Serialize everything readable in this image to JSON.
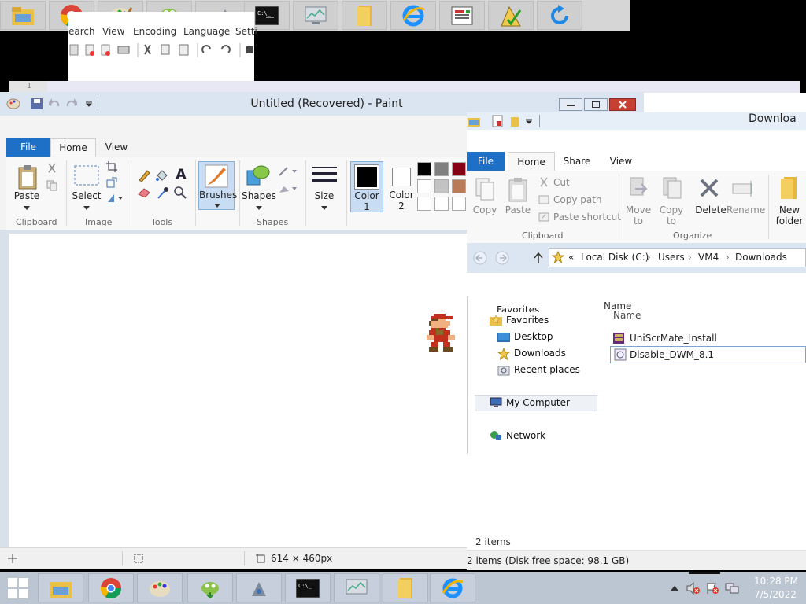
{
  "top_taskbar": {
    "icons": [
      "file-explorer-icon",
      "chrome-icon",
      "paint-icon",
      "notepadpp-icon",
      "utility-icon",
      "cmd-icon",
      "monitor-icon",
      "folder-icon",
      "ie-icon",
      "presentation-icon",
      "accessibility-icon",
      "refresh-icon"
    ]
  },
  "notepadpp": {
    "menu": [
      "earch",
      "View",
      "Encoding",
      "Language",
      "Setti"
    ],
    "line_number": "1"
  },
  "paint": {
    "title": "Untitled (Recovered) - Paint",
    "tabs": {
      "file": "File",
      "home": "Home",
      "view": "View"
    },
    "clipboard": {
      "paste": "Paste",
      "group": "Clipboard"
    },
    "image": {
      "select": "Select",
      "group": "Image"
    },
    "tools": {
      "group": "Tools"
    },
    "brushes": {
      "label": "Brushes"
    },
    "shapes": {
      "label": "Shapes",
      "group": "Shapes"
    },
    "size": {
      "label": "Size"
    },
    "color1": {
      "label": "Color",
      "num": "1"
    },
    "color2": {
      "label": "Color",
      "num": "2"
    },
    "status": {
      "dimensions": "614 × 460px"
    },
    "palette": [
      "#000000",
      "#7f7f7f",
      "#880015",
      "#ffffff",
      "#c3c3c3",
      "#b97a57",
      "#ffffff",
      "#ffffff",
      "#ffffff"
    ]
  },
  "explorer": {
    "title": "Downloa",
    "tabs": {
      "file": "File",
      "home": "Home",
      "share": "Share",
      "view": "View"
    },
    "clipboard": {
      "copy": "Copy",
      "paste": "Paste",
      "cut": "Cut",
      "copy_path": "Copy path",
      "paste_shortcut": "Paste shortcut",
      "group": "Clipboard"
    },
    "organize": {
      "move_to": "Move",
      "move_to2": "to",
      "copy_to": "Copy",
      "copy_to2": "to",
      "delete": "Delete",
      "rename": "Rename",
      "group": "Organize"
    },
    "new": {
      "folder1": "New",
      "folder2": "folder"
    },
    "address": {
      "prefix": "«",
      "path": [
        "Local Disk (C:)",
        "Users",
        "VM4",
        "Downloads"
      ]
    },
    "header_name_1": "Name",
    "header_name_2": "Name",
    "nav": {
      "favorites_cut": "Favorites",
      "favorites": "Favorites",
      "desktop": "Desktop",
      "downloads": "Downloads",
      "recent": "Recent places",
      "my_computer": "My Computer",
      "network": "Network"
    },
    "files": [
      "UniScrMate_Install",
      "Disable_DWM_8.1"
    ],
    "item_count": "2 items",
    "status": "2 items (Disk free space: 98.1 GB)"
  },
  "taskbar": {
    "time": "10:28 PM",
    "date": "7/5/2022"
  }
}
